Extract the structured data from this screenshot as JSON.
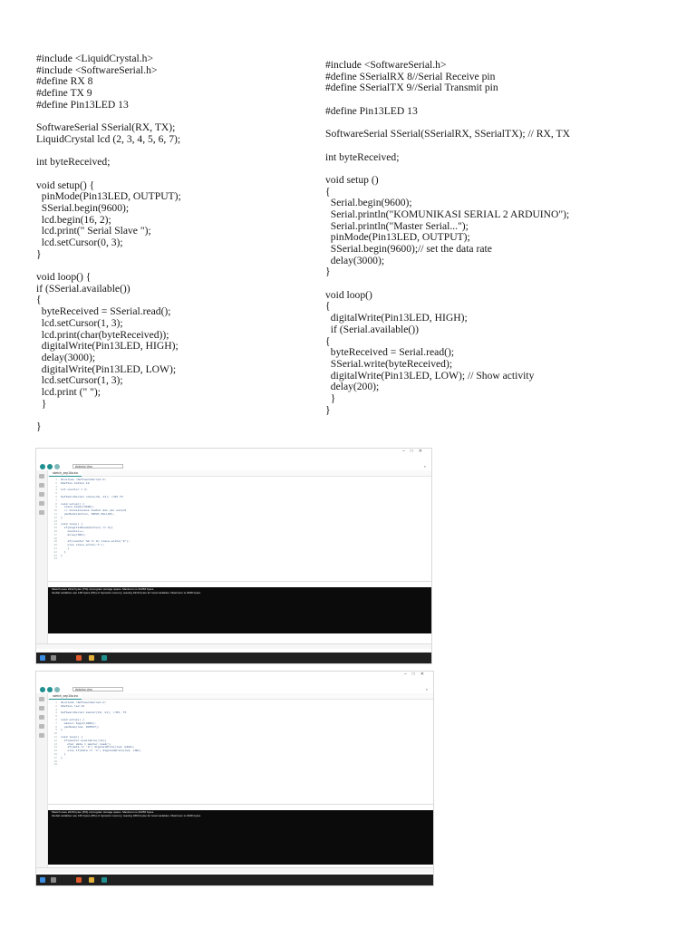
{
  "code_left": [
    "#include <LiquidCrystal.h>",
    "#include <SoftwareSerial.h>",
    "#define RX 8",
    "#define TX 9",
    "#define Pin13LED 13",
    "",
    "SoftwareSerial SSerial(RX, TX);",
    "LiquidCrystal lcd (2, 3, 4, 5, 6, 7);",
    "",
    "int byteReceived;",
    "",
    "void setup() {",
    "  pinMode(Pin13LED, OUTPUT);",
    "  SSerial.begin(9600);",
    "  lcd.begin(16, 2);",
    "  lcd.print(\" Serial Slave \");",
    "  lcd.setCursor(0, 3);",
    "}",
    "",
    "void loop() {",
    "if (SSerial.available())",
    "{",
    "  byteReceived = SSerial.read();",
    "  lcd.setCursor(1, 3);",
    "  lcd.print(char(byteReceived));",
    "  digitalWrite(Pin13LED, HIGH);",
    "  delay(3000);",
    "  digitalWrite(Pin13LED, LOW);",
    "  lcd.setCursor(1, 3);",
    "  lcd.print (\" \");",
    "  }",
    "",
    "}"
  ],
  "code_right": [
    "#include <SoftwareSerial.h>",
    "#define SSerialRX 8//Serial Receive pin",
    "#define SSerialTX 9//Serial Transmit pin",
    "",
    "#define Pin13LED 13",
    "",
    "SoftwareSerial SSerial(SSerialRX, SSerialTX); // RX, TX",
    "",
    "int byteReceived;",
    "",
    "void setup ()",
    "{",
    "  Serial.begin(9600);",
    "  Serial.println(\"KOMUNIKASI SERIAL 2 ARDUINO\");",
    "  Serial.println(\"Master Serial...\");",
    "  pinMode(Pin13LED, OUTPUT);",
    "  SSerial.begin(9600);// set the data rate",
    "  delay(3000);",
    "}",
    "",
    "void loop()",
    "{",
    "  digitalWrite(Pin13LED, HIGH);",
    "  if (Serial.available())",
    "{",
    "  byteReceived = Serial.read();",
    "  SSerial.write(byteReceived);",
    "  digitalWrite(Pin13LED, LOW); // Show activity",
    "  delay(200);",
    "  }",
    "}"
  ],
  "ide1": {
    "menu": [
      "File",
      "Edit",
      "Sketch",
      "Tools",
      "Help"
    ],
    "board": "Arduino Uno",
    "tab": "sketch_sep16a.ino",
    "output_label": "Output",
    "line_numbers": [
      "1",
      "2",
      "3",
      "4",
      "5",
      "6",
      "7",
      "8",
      "9",
      "10",
      "11",
      "12",
      "13",
      "14",
      "15",
      "16",
      "17",
      "18",
      "19",
      "20",
      "21",
      "22",
      "23",
      "24"
    ],
    "source": [
      "#include <SoftwareSerial.h>",
      "#define button 12",
      "",
      "int counter = 1;",
      "",
      "SoftwareSerial slave(10, 11); //RX TX",
      "",
      "void setup() {",
      "  slave.begin(9600);",
      "  // inisialisasi tombol dan pin output",
      "  pinMode(button, INPUT_PULLUP);",
      "}",
      "",
      "void loop() {",
      "  if(digitalRead(button) == 0){",
      "    counter++;",
      "    delay(500);",
      "",
      "    if(counter %2 == 0) slave.write('0');",
      "    else slave.write('1');",
      "    }",
      "  }",
      "}",
      ""
    ],
    "console": [
      "Sketch uses 2412 bytes (7%) of program storage space. Maximum is 32256 bytes.",
      "Global variables use 138 bytes (6%) of dynamic memory, leaving 1910 bytes for local variables. Maximum is 2048 bytes."
    ]
  },
  "ide2": {
    "menu": [
      "File",
      "Edit",
      "Sketch",
      "Tools",
      "Help"
    ],
    "board": "Arduino Uno",
    "tab": "sketch_sep16a.ino",
    "output_label": "Output",
    "line_numbers": [
      "1",
      "2",
      "3",
      "4",
      "5",
      "6",
      "7",
      "8",
      "9",
      "10",
      "11",
      "12",
      "13",
      "14",
      "15",
      "16",
      "17",
      "18",
      "19"
    ],
    "source": [
      "#include <SoftwareSerial.h>",
      "#define led 13",
      "",
      "SoftwareSerial master(10, 11); //RX, TX",
      "",
      "void setup() {",
      "  master.begin(9600);",
      "  pinMode(led, OUTPUT);",
      "}",
      "",
      "void loop() {",
      "  if(master.available()>0){",
      "    char data = master.read();",
      "    if(data == '0') digitalWrite(led, HIGH);",
      "    else if(data == '1') digitalWrite(led, LOW);",
      "  }",
      "}",
      "",
      ""
    ],
    "console": [
      "Sketch uses 2218 bytes (6%) of program storage space. Maximum is 32256 bytes.",
      "Global variables use 184 bytes (8%) of dynamic memory, leaving 1864 bytes for local variables. Maximum is 2048 bytes."
    ]
  }
}
